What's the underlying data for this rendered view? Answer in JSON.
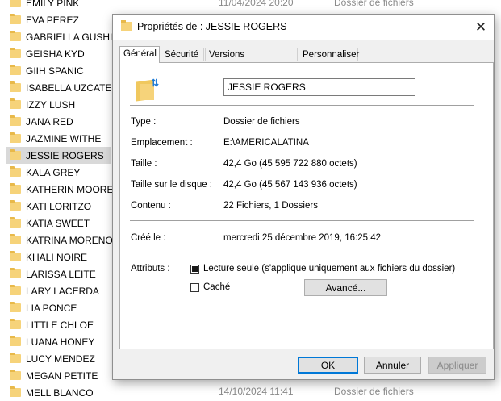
{
  "explorer": {
    "folders": [
      "EMILY PINK",
      "EVA PEREZ",
      "GABRIELLA GUSHI",
      "GEISHA KYD",
      "GIIH SPANIC",
      "ISABELLA UZCATEGU",
      "IZZY LUSH",
      "JANA RED",
      "JAZMINE WITHE",
      "JESSIE ROGERS",
      "KALA GREY",
      "KATHERIN MOORE",
      "KATI LORITZO",
      "KATIA SWEET",
      "KATRINA MORENO",
      "KHALI NOIRE",
      "LARISSA LEITE",
      "LARY LACERDA",
      "LIA PONCE",
      "LITTLE CHLOE",
      "LUANA HONEY",
      "LUCY MENDEZ",
      "MEGAN PETITE",
      "MELL BLANCO"
    ],
    "selected_index": 9,
    "top_row": {
      "date": "11/04/2024 20:20",
      "type": "Dossier de fichiers"
    },
    "bottom_row": {
      "date": "14/10/2024 11:41",
      "type": "Dossier de fichiers"
    }
  },
  "dialog": {
    "title": "Propriétés de : JESSIE ROGERS",
    "close_glyph": "✕",
    "tabs": [
      "Général",
      "Sécurité",
      "Versions précédentes",
      "Personnaliser"
    ],
    "active_tab": 0,
    "folder_name": "JESSIE ROGERS",
    "props": {
      "type_label": "Type :",
      "type_value": "Dossier de fichiers",
      "location_label": "Emplacement :",
      "location_value": "E:\\AMERICALATINA",
      "size_label": "Taille :",
      "size_value": "42,4 Go (45 595 722 880 octets)",
      "disk_size_label": "Taille sur le disque :",
      "disk_size_value": "42,4 Go (45 567 143 936 octets)",
      "contents_label": "Contenu :",
      "contents_value": "22 Fichiers, 1 Dossiers",
      "created_label": "Créé le :",
      "created_value": "mercredi 25 décembre 2019, 16:25:42",
      "attributes_label": "Attributs :"
    },
    "attributes": {
      "readonly_label": "Lecture seule (s'applique uniquement aux fichiers du dossier)",
      "readonly_checked": "indeterminate",
      "hidden_label": "Caché",
      "hidden_checked": false,
      "advanced_button": "Avancé..."
    },
    "buttons": {
      "ok": "OK",
      "cancel": "Annuler",
      "apply": "Appliquer"
    }
  }
}
